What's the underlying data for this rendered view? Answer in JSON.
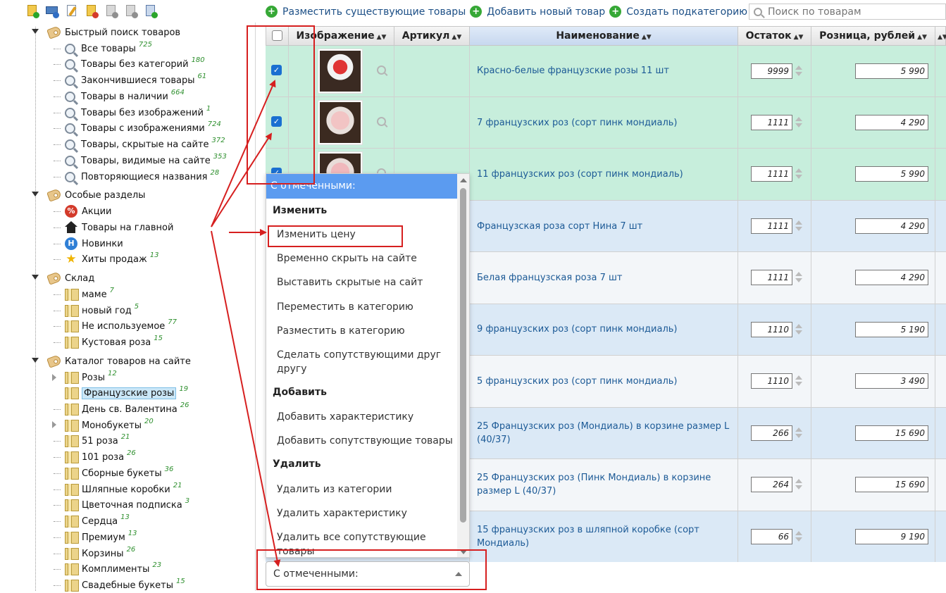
{
  "toolbar": {
    "icons": [
      "add-product-icon",
      "display-icon",
      "edit-icon",
      "delete-icon",
      "import-icon",
      "export-icon",
      "excel-icon"
    ]
  },
  "top_links": [
    {
      "label": "Разместить существующие товары"
    },
    {
      "label": "Добавить новый товар"
    },
    {
      "label": "Создать подкатегорию"
    }
  ],
  "search": {
    "placeholder": "Поиск по товарам"
  },
  "tree": {
    "quick_search": {
      "title": "Быстрый поиск товаров",
      "items": [
        {
          "label": "Все товары",
          "count": "725"
        },
        {
          "label": "Товары без категорий",
          "count": "180"
        },
        {
          "label": "Закончившиеся товары",
          "count": "61"
        },
        {
          "label": "Товары в наличии",
          "count": "664"
        },
        {
          "label": "Товары без изображений",
          "count": "1"
        },
        {
          "label": "Товары с изображениями",
          "count": "724"
        },
        {
          "label": "Товары, скрытые на сайте",
          "count": "372"
        },
        {
          "label": "Товары, видимые на сайте",
          "count": "353"
        },
        {
          "label": "Повторяющиеся названия",
          "count": "28"
        }
      ]
    },
    "special": {
      "title": "Особые разделы",
      "items": [
        {
          "label": "Акции",
          "count": ""
        },
        {
          "label": "Товары на главной",
          "count": ""
        },
        {
          "label": "Новинки",
          "count": ""
        },
        {
          "label": "Хиты продаж",
          "count": "13"
        }
      ]
    },
    "warehouse": {
      "title": "Склад",
      "items": [
        {
          "label": "маме",
          "count": "7"
        },
        {
          "label": "новый год",
          "count": "5"
        },
        {
          "label": "Не используемое",
          "count": "77"
        },
        {
          "label": "Кустовая роза",
          "count": "15"
        }
      ]
    },
    "catalog": {
      "title": "Каталог товаров на сайте",
      "items": [
        {
          "label": "Розы",
          "count": "12"
        },
        {
          "label": "Французские розы",
          "count": "19"
        },
        {
          "label": "День св. Валентина",
          "count": "26"
        },
        {
          "label": "Монобукеты",
          "count": "20"
        },
        {
          "label": "51 роза",
          "count": "21"
        },
        {
          "label": "101 роза",
          "count": "26"
        },
        {
          "label": "Сборные букеты",
          "count": "36"
        },
        {
          "label": "Шляпные коробки",
          "count": "21"
        },
        {
          "label": "Цветочная подписка",
          "count": "3"
        },
        {
          "label": "Сердца",
          "count": "13"
        },
        {
          "label": "Премиум",
          "count": "13"
        },
        {
          "label": "Корзины",
          "count": "26"
        },
        {
          "label": "Комплименты",
          "count": "23"
        },
        {
          "label": "Свадебные букеты",
          "count": "15"
        }
      ]
    }
  },
  "table": {
    "headers": {
      "image": "Изображение",
      "sku": "Артикул",
      "name": "Наименование",
      "stock": "Остаток",
      "price": "Розница, рублей"
    },
    "rows": [
      {
        "name": "Красно-белые французские розы 11 шт",
        "stock": "9999",
        "price": "5 990"
      },
      {
        "name": "7 французских роз (сорт пинк мондиаль)",
        "stock": "1111",
        "price": "4 290"
      },
      {
        "name": "11 французских роз (сорт пинк мондиаль)",
        "stock": "1111",
        "price": "5 990"
      },
      {
        "name": "Французская роза сорт Нина 7 шт",
        "stock": "1111",
        "price": "4 290"
      },
      {
        "name": "Белая французская роза 7 шт",
        "stock": "1111",
        "price": "4 290"
      },
      {
        "name": "9 французских роз (сорт пинк мондиаль)",
        "stock": "1110",
        "price": "5 190"
      },
      {
        "name": "5 французских роз (сорт пинк мондиаль)",
        "stock": "1110",
        "price": "3 490"
      },
      {
        "name": "25 Французских роз (Мондиаль) в корзине размер L (40/37)",
        "stock": "266",
        "price": "15 690"
      },
      {
        "name": "25 Французских роз (Пинк Мондиаль) в корзине размер L (40/37)",
        "stock": "264",
        "price": "15 690"
      },
      {
        "name": "15 французских роз в шляпной коробке (сорт Мондиаль)",
        "stock": "66",
        "price": "9 190"
      }
    ]
  },
  "menu": {
    "header": "С отмеченными:",
    "groups": {
      "edit": "Изменить",
      "add": "Добавить",
      "delete": "Удалить"
    },
    "items": {
      "change_price": "Изменить цену",
      "hide": "Временно скрыть на сайте",
      "show_hidden": "Выставить скрытые на сайт",
      "move": "Переместить в категорию",
      "place": "Разместить в категорию",
      "related_each": "Сделать сопутствующими друг другу",
      "add_feature": "Добавить характеристику",
      "add_related": "Добавить сопутствующие товары",
      "remove_from_cat": "Удалить из категории",
      "remove_feature": "Удалить характеристику",
      "remove_all_related": "Удалить все сопутствующие товары"
    }
  },
  "bulk_select": {
    "value": "С отмеченными:"
  },
  "colors": {
    "annotation": "#d61f1f",
    "selected_row": "#c7eedc",
    "menu_header": "#5b9bf0",
    "link": "#1c5a96"
  }
}
